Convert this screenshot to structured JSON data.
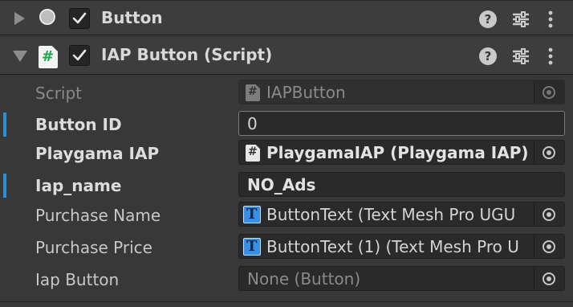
{
  "components": [
    {
      "title": "Button",
      "expanded": false,
      "enabled": true
    },
    {
      "title": "IAP Button (Script)",
      "expanded": true,
      "enabled": true,
      "icon_label": "#"
    }
  ],
  "fields": {
    "script": {
      "label": "Script",
      "value": "IAPButton"
    },
    "button_id": {
      "label": "Button ID",
      "value": "0"
    },
    "playgama_iap": {
      "label": "Playgama IAP",
      "value": "PlaygamaIAP (Playgama IAP)"
    },
    "iap_name": {
      "label": "Iap_name",
      "value": "NO_Ads"
    },
    "purchase_name": {
      "label": "Purchase Name",
      "value": "ButtonText (Text Mesh Pro UGU"
    },
    "purchase_price": {
      "label": "Purchase Price",
      "value": "ButtonText (1) (Text Mesh Pro U"
    },
    "iap_button": {
      "label": "Iap Button",
      "value": "None (Button)"
    }
  },
  "icons": {
    "hash": "#",
    "tmp": "T",
    "help": "?"
  },
  "colors": {
    "accent_marker": "#2f8fd6",
    "script_icon": "#17a74b",
    "tmp_icon": "#3a8ee6"
  }
}
